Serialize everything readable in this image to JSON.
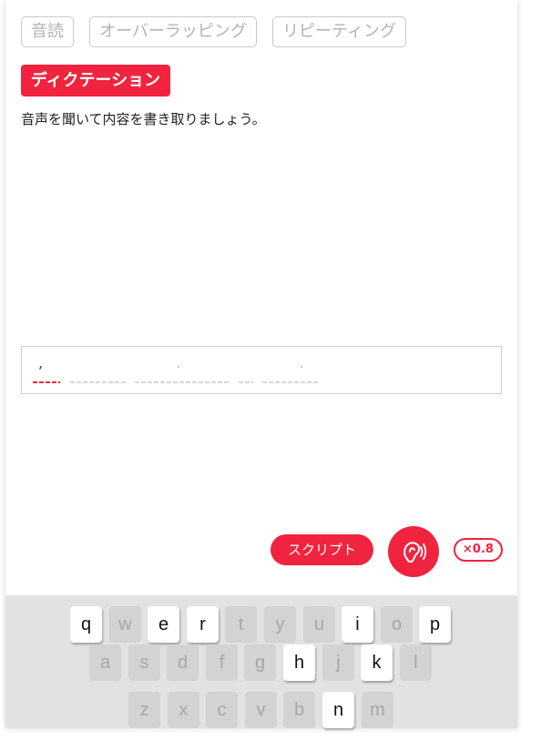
{
  "tabs": [
    {
      "label": "音読"
    },
    {
      "label": "オーバーラッピング"
    },
    {
      "label": "リピーティング"
    }
  ],
  "section": {
    "badge": "ディクテーション",
    "instruction": "音声を聞いて内容を書き取りましょう。"
  },
  "answer": {
    "comma": ","
  },
  "controls": {
    "script_label": "スクリプト",
    "speed_label": "×0.8",
    "listen_icon": "ear-listen-icon"
  },
  "colors": {
    "accent": "#f0243e",
    "key_disabled": "#d3d3d3",
    "keyboard_bg": "#e2e2e2"
  },
  "keyboard": {
    "rows": [
      [
        {
          "key": "q",
          "enabled": true
        },
        {
          "key": "w",
          "enabled": false
        },
        {
          "key": "e",
          "enabled": true
        },
        {
          "key": "r",
          "enabled": true
        },
        {
          "key": "t",
          "enabled": false
        },
        {
          "key": "y",
          "enabled": false
        },
        {
          "key": "u",
          "enabled": false
        },
        {
          "key": "i",
          "enabled": true
        },
        {
          "key": "o",
          "enabled": false
        },
        {
          "key": "p",
          "enabled": true
        }
      ],
      [
        {
          "key": "a",
          "enabled": false
        },
        {
          "key": "s",
          "enabled": false
        },
        {
          "key": "d",
          "enabled": false
        },
        {
          "key": "f",
          "enabled": false
        },
        {
          "key": "g",
          "enabled": false
        },
        {
          "key": "h",
          "enabled": true
        },
        {
          "key": "j",
          "enabled": false
        },
        {
          "key": "k",
          "enabled": true
        },
        {
          "key": "l",
          "enabled": false
        }
      ],
      [
        {
          "key": "z",
          "enabled": false
        },
        {
          "key": "x",
          "enabled": false
        },
        {
          "key": "c",
          "enabled": false
        },
        {
          "key": "v",
          "enabled": false
        },
        {
          "key": "b",
          "enabled": false
        },
        {
          "key": "n",
          "enabled": true
        },
        {
          "key": "m",
          "enabled": false
        }
      ]
    ]
  }
}
